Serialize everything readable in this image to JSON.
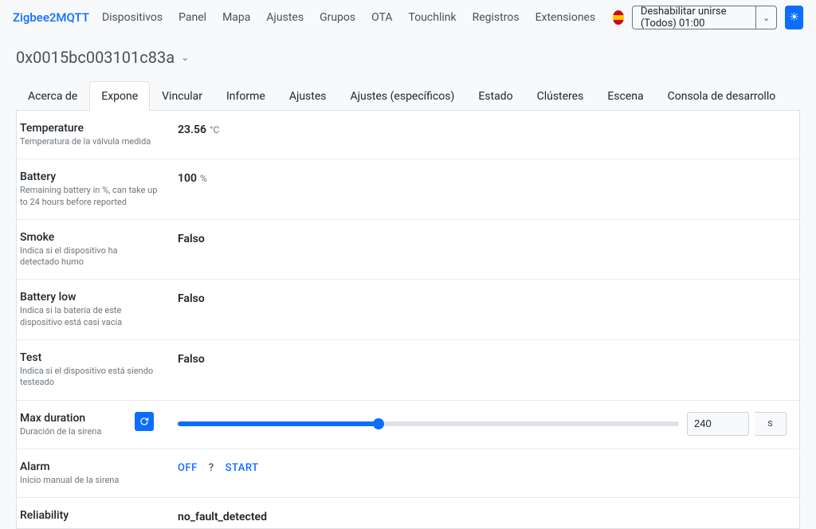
{
  "brand": "Zigbee2MQTT",
  "nav": [
    "Dispositivos",
    "Panel",
    "Mapa",
    "Ajustes",
    "Grupos",
    "OTA",
    "Touchlink",
    "Registros",
    "Extensiones"
  ],
  "join": {
    "label": "Deshabilitar unirse (Todos) 01:00"
  },
  "device_id": "0x0015bc003101c83a",
  "tabs": [
    "Acerca de",
    "Expone",
    "Vincular",
    "Informe",
    "Ajustes",
    "Ajustes (específicos)",
    "Estado",
    "Clústeres",
    "Escena",
    "Consola de desarrollo"
  ],
  "active_tab": 1,
  "rows": {
    "temperature": {
      "title": "Temperature",
      "sub": "Temperatura de la válvula medida",
      "value": "23.56",
      "unit": "°C"
    },
    "battery": {
      "title": "Battery",
      "sub": "Remaining battery in %, can take up to 24 hours before reported",
      "value": "100",
      "unit": "%"
    },
    "smoke": {
      "title": "Smoke",
      "sub": "Indica si el dispositivo ha detectado humo",
      "value": "Falso"
    },
    "battery_low": {
      "title": "Battery low",
      "sub": "Indica si la batería de este dispositivo está casi vacía",
      "value": "Falso"
    },
    "test": {
      "title": "Test",
      "sub": "Indica si el dispositivo está siendo testeado",
      "value": "Falso"
    },
    "max_duration": {
      "title": "Max duration",
      "sub": "Duración de la sirena",
      "value": "240",
      "unit": "s"
    },
    "alarm": {
      "title": "Alarm",
      "sub": "Inicio manual de la sirena",
      "off": "OFF",
      "unknown": "?",
      "start": "START"
    },
    "reliability": {
      "title": "Reliability",
      "sub": "",
      "value": "no_fault_detected"
    }
  }
}
